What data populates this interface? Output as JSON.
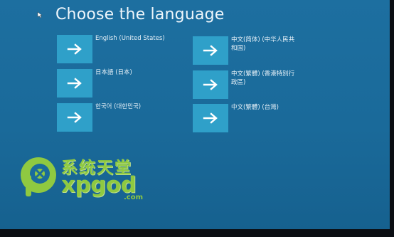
{
  "page": {
    "title": "Choose the language"
  },
  "languages": [
    {
      "label": "English (United States)",
      "icon": "arrow-right-icon"
    },
    {
      "label": "中文(简体) (中华人民共和国)",
      "icon": "arrow-right-icon"
    },
    {
      "label": "日本語 (日本)",
      "icon": "arrow-right-icon"
    },
    {
      "label": "中文(繁體) (香港特別行政區)",
      "icon": "arrow-right-icon"
    },
    {
      "label": "한국어 (대한민국)",
      "icon": "arrow-right-icon"
    },
    {
      "label": "中文(繁體) (台灣)",
      "icon": "arrow-right-icon"
    }
  ],
  "watermark": {
    "chinese": "系统天堂",
    "english": "xpgod",
    "suffix": ".com"
  },
  "colors": {
    "background": "#1b6c9d",
    "tile": "#2fa0c9",
    "text": "#e6f1f8",
    "watermark": "#9ad23a"
  }
}
